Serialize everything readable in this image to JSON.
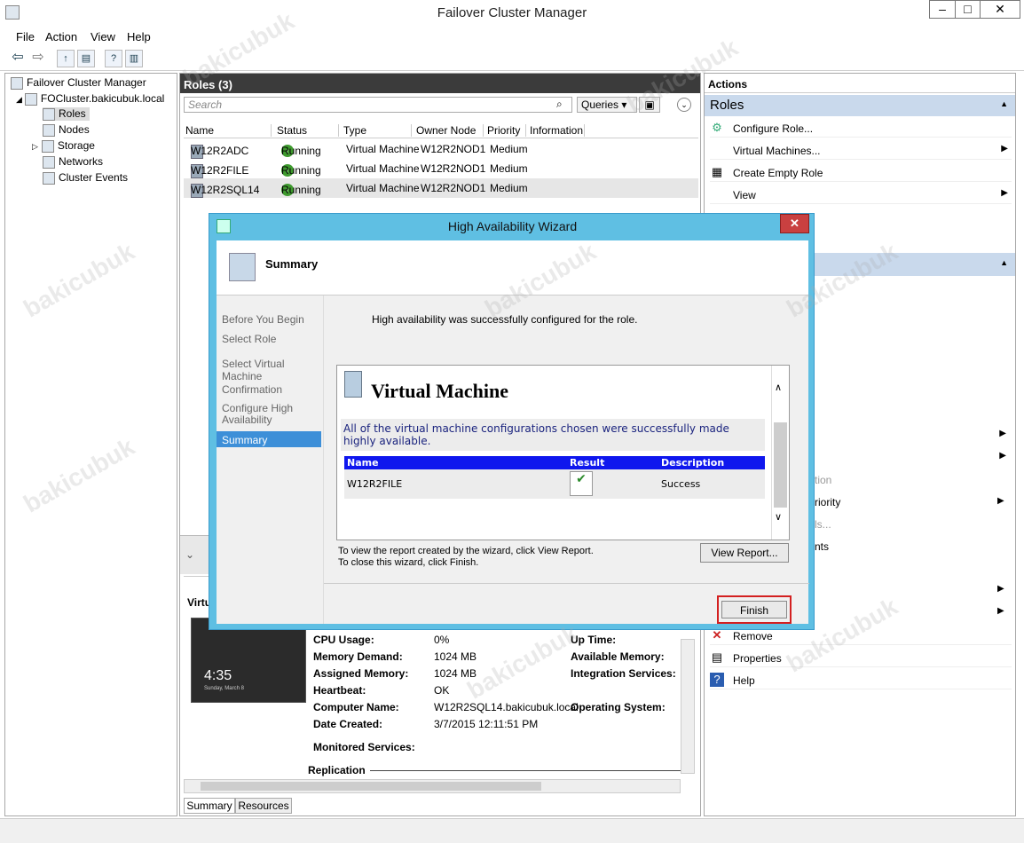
{
  "window": {
    "title": "Failover Cluster Manager"
  },
  "menu": [
    "File",
    "Action",
    "View",
    "Help"
  ],
  "tree": {
    "root": "Failover Cluster Manager",
    "cluster": "FOCluster.bakicubuk.local",
    "items": [
      "Roles",
      "Nodes",
      "Storage",
      "Networks",
      "Cluster Events"
    ]
  },
  "roles": {
    "header": "Roles (3)",
    "search_placeholder": "Search",
    "queries_label": "Queries",
    "columns": [
      "Name",
      "Status",
      "Type",
      "Owner Node",
      "Priority",
      "Information"
    ],
    "rows": [
      {
        "name": "W12R2ADC",
        "status": "Running",
        "type": "Virtual Machine",
        "owner": "W12R2NOD1",
        "priority": "Medium"
      },
      {
        "name": "W12R2FILE",
        "status": "Running",
        "type": "Virtual Machine",
        "owner": "W12R2NOD1",
        "priority": "Medium"
      },
      {
        "name": "W12R2SQL14",
        "status": "Running",
        "type": "Virtual Machine",
        "owner": "W12R2NOD1",
        "priority": "Medium"
      }
    ]
  },
  "detail": {
    "title_fragment": "Virtu",
    "thumb_time": "4:35",
    "thumb_date": "Sunday, March 8",
    "fields": [
      {
        "label": "CPU Usage:",
        "value": "0%"
      },
      {
        "label": "Memory Demand:",
        "value": "1024 MB"
      },
      {
        "label": "Assigned Memory:",
        "value": "1024 MB"
      },
      {
        "label": "Heartbeat:",
        "value": "OK"
      },
      {
        "label": "Computer Name:",
        "value": "W12R2SQL14.bakicubuk.local"
      },
      {
        "label": "Date Created:",
        "value": "3/7/2015 12:11:51 PM"
      },
      {
        "label": "Monitored Services:",
        "value": ""
      }
    ],
    "right_fields": [
      "Up Time:",
      "Available Memory:",
      "Integration Services:",
      "Operating System:"
    ],
    "replication_label": "Replication",
    "tabs": [
      "Summary",
      "Resources"
    ]
  },
  "actions": {
    "header": "Actions",
    "section": "Roles",
    "items": [
      "Configure Role...",
      "Virtual Machines...",
      "Create Empty Role",
      "View"
    ],
    "fragments": [
      "tion",
      "riority",
      "ls...",
      "nts"
    ],
    "bottom_items": [
      "Remove",
      "Properties",
      "Help"
    ]
  },
  "wizard": {
    "title": "High Availability Wizard",
    "page_title": "Summary",
    "steps": [
      "Before You Begin",
      "Select Role",
      "Select Virtual Machine",
      "Confirmation",
      "Configure High Availability",
      "Summary"
    ],
    "message": "High availability was successfully configured for the role.",
    "report_heading": "Virtual Machine",
    "report_text": "All of the virtual machine configurations chosen were successfully made highly available.",
    "table_headers": [
      "Name",
      "Result",
      "Description"
    ],
    "table_row": {
      "name": "W12R2FILE",
      "description": "Success"
    },
    "hint1": "To view the report created by the wizard, click View Report.",
    "hint2": "To close this wizard, click Finish.",
    "view_report": "View Report...",
    "finish": "Finish"
  },
  "watermark": "bakicubuk"
}
